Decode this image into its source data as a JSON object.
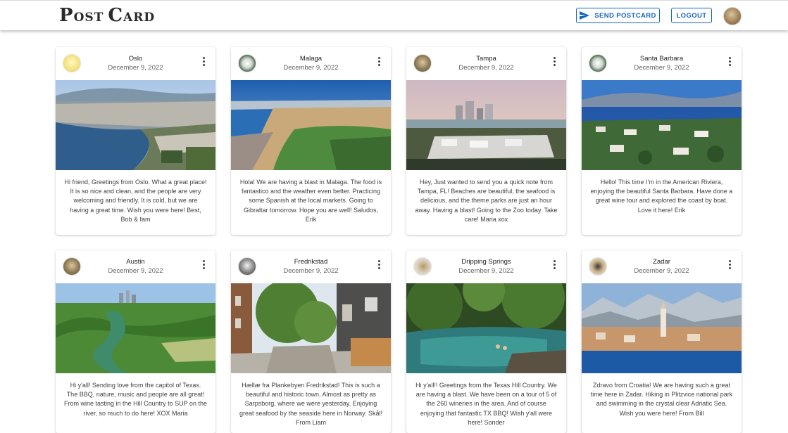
{
  "app": {
    "logo_big_1": "P",
    "logo_small_1": "OST",
    "logo_big_2": "C",
    "logo_small_2": "ARD",
    "send_label": "SEND POSTCARD",
    "logout_label": "LOGOUT",
    "accent": "#1565c0"
  },
  "cards": [
    {
      "city": "Oslo",
      "date": "December 9, 2022",
      "message": "Hi friend, Greetings from Oslo. What a great place! It is so nice and clean, and the people are very welcoming and friendly. It is cold, but we are having a great time. Wish you were here! Best, Bob & fam"
    },
    {
      "city": "Malaga",
      "date": "December 9, 2022",
      "message": "Hola! We are having a blast in Malaga. The food is fantastico and the weather even better. Practicing some Spanish at the local markets. Going to Gibraltar tomorrow. Hope you are well! Saludos, Erik"
    },
    {
      "city": "Tampa",
      "date": "December 9, 2022",
      "message": "Hey, Just wanted to send you a quick note from Tampa, FL! Beaches are beautiful, the seafood is delicious, and the theme parks are just an hour away. Having a blast! Going to the Zoo today. Take care! Maria xox"
    },
    {
      "city": "Santa Barbara",
      "date": "December 9, 2022",
      "message": "Hello! This time I'm in the American Riviera, enjoying the beautiful Santa Barbara. Have done a great wine tour and explored the coast by boat. Love it here! Erik"
    },
    {
      "city": "Austin",
      "date": "December 9, 2022",
      "message": "Hi y'all! Sending love from the capitol of Texas. The BBQ, nature, music and people are all great! From wine tasting in the Hill Country to SUP on the river, so much to do here! XOX Maria"
    },
    {
      "city": "Fredrikstad",
      "date": "December 9, 2022",
      "message": "Hællæ fra Plankebyen Fredrikstad! This is such a beautiful and historic town. Almost as pretty as Sarpsborg, where we were yesterday. Enjoying great seafood by the seaside here in Norway. Skål! From Liam"
    },
    {
      "city": "Dripping Springs",
      "date": "December 9, 2022",
      "message": "Hi y'all!! Greetings from the Texas Hill Country. We are having a blast. We have been on a tour of 5 of the 260 wineries in the area. And of course enjoying that fantastic TX BBQ! Wish y'all were here! Sonder"
    },
    {
      "city": "Zadar",
      "date": "December 9, 2022",
      "message": "Zdravo from Croatia! We are having such a great time here in Zadar. Hiking in Plitzvice national park and swimming in the crystal clear Adriatic Sea. Wish you were here! From Bill"
    }
  ]
}
